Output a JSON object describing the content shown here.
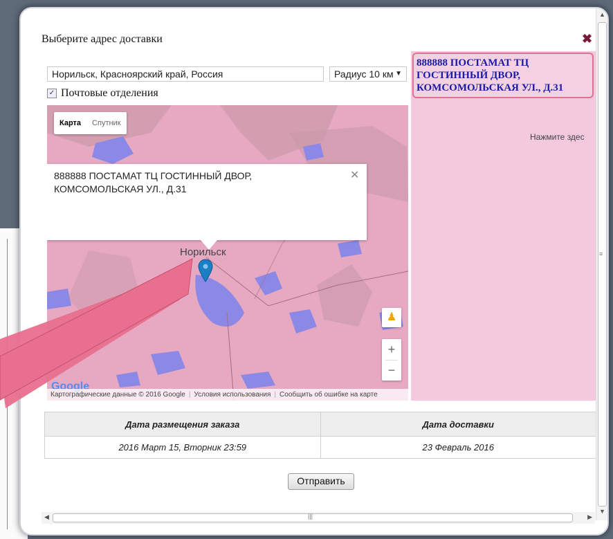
{
  "dialog": {
    "title": "Выберите адрес доставки",
    "close_glyph": "✖"
  },
  "search": {
    "address_value": "Норильск, Красноярский край, Россия",
    "radius_value": "Радиус 10 км"
  },
  "filter": {
    "post_offices_label": "Почтовые отделения",
    "post_offices_checked": true
  },
  "map": {
    "type_buttons": [
      "Карта",
      "Спутник"
    ],
    "active_type": "Карта",
    "popup_text": "888888 ПОСТАМАТ ТЦ ГОСТИННЫЙ ДВОР, КОМСОМОЛЬСКАЯ УЛ., Д.31",
    "city_label": "Норильск",
    "zoom_in": "+",
    "zoom_out": "−",
    "logo": "Google",
    "attribution": [
      "Картографические данные © 2016 Google",
      "Условия использования",
      "Сообщить об ошибке на карте"
    ],
    "land_color": "#e7a9c2",
    "water_color": "#8b88e6"
  },
  "side_panel": {
    "selected_point": "888888 ПОСТАМАТ ТЦ ГОСТИННЫЙ ДВОР, КОМСОМОЛЬСКАЯ УЛ., Д.31",
    "hint": "Нажмите здес",
    "title_color": "#1a1aa8"
  },
  "order_table": {
    "headers": [
      "Дата размещения заказа",
      "Дата доставки"
    ],
    "rows": [
      [
        "2016 Март 15, Вторник 23:59",
        "23 Февраль 2016"
      ]
    ]
  },
  "actions": {
    "submit_label": "Отправить"
  },
  "annotation": {
    "arrow_color": "#e8708e"
  }
}
